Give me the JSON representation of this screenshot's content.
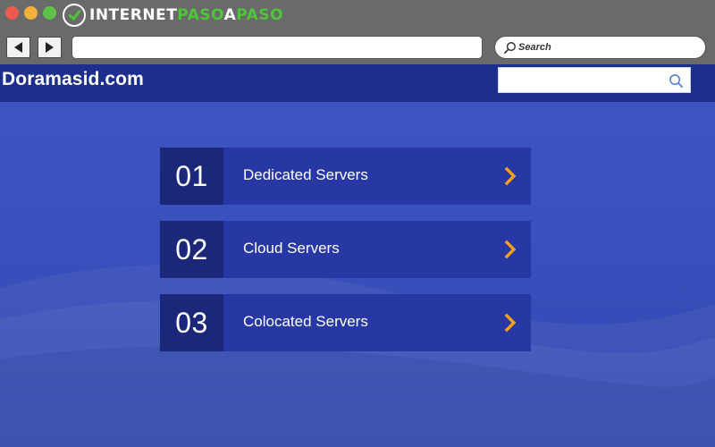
{
  "browser": {
    "brand_part1": "INTERNET",
    "brand_part2": "PASO",
    "brand_part3": "A",
    "brand_part4": "PASO",
    "search_placeholder": "Search",
    "url_value": ""
  },
  "site": {
    "logo_text": "Doramasid.com",
    "search_value": ""
  },
  "menu": [
    {
      "number": "01",
      "label": "Dedicated Servers"
    },
    {
      "number": "02",
      "label": "Cloud Servers"
    },
    {
      "number": "03",
      "label": "Colocated Servers"
    }
  ],
  "icons": {
    "window_controls": [
      "close-dot-icon",
      "minimize-dot-icon",
      "zoom-dot-icon"
    ],
    "nav": [
      "back-arrow-icon",
      "forward-arrow-icon"
    ],
    "search": "search-icon",
    "menu_arrow": "chevron-right-icon"
  },
  "colors": {
    "page_bg": "#3e55c2",
    "site_header": "#1e2e8c",
    "menu_number_bg": "#1b2779",
    "menu_body_bg": "#2737a3",
    "chevron": "#f5a21b",
    "brand_green": "#4fc53a"
  }
}
